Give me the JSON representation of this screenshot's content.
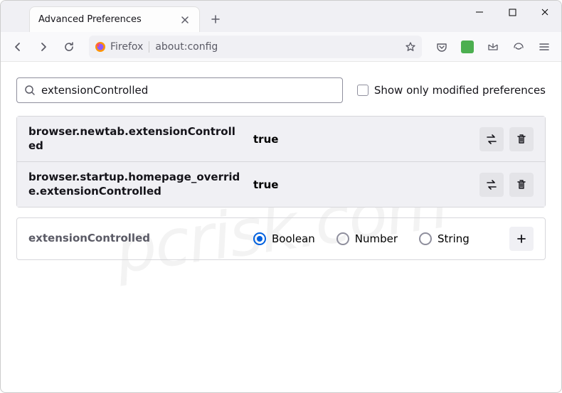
{
  "tab": {
    "title": "Advanced Preferences"
  },
  "urlbar": {
    "identity_label": "Firefox",
    "url": "about:config"
  },
  "content": {
    "search_value": "extensionControlled",
    "show_modified_label": "Show only modified preferences",
    "prefs": [
      {
        "name": "browser.newtab.extensionControlled",
        "value": "true"
      },
      {
        "name": "browser.startup.homepage_override.extensionControlled",
        "value": "true"
      }
    ],
    "new_pref": {
      "name": "extensionControlled",
      "types": {
        "boolean": "Boolean",
        "number": "Number",
        "string": "String"
      },
      "selected": "boolean"
    }
  },
  "watermark": "pcrisk.com"
}
